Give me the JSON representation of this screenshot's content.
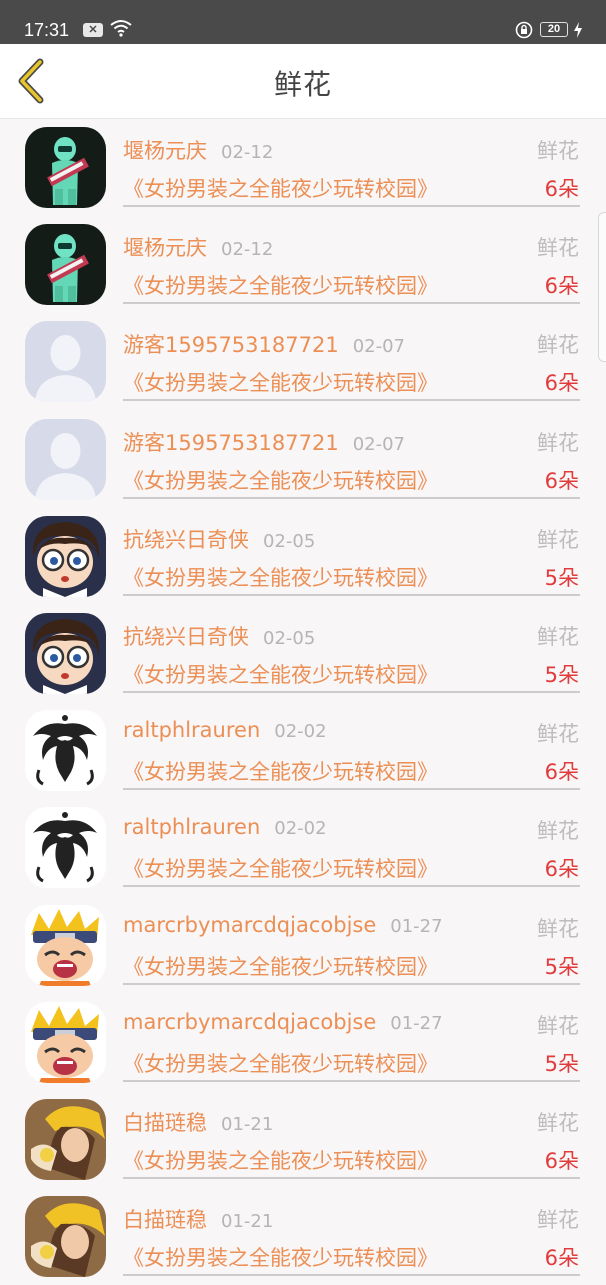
{
  "status": {
    "time": "17:31",
    "battery": "20"
  },
  "header": {
    "title": "鲜花"
  },
  "list": [
    {
      "name": "堰杨元庆",
      "date": "02-12",
      "gift": "鲜花",
      "book": "《女扮男装之全能夜少玩转校园》",
      "count": "6朵",
      "avatar": "astronaut-keytar"
    },
    {
      "name": "堰杨元庆",
      "date": "02-12",
      "gift": "鲜花",
      "book": "《女扮男装之全能夜少玩转校园》",
      "count": "6朵",
      "avatar": "astronaut-keytar"
    },
    {
      "name": "游客1595753187721",
      "date": "02-07",
      "gift": "鲜花",
      "book": "《女扮男装之全能夜少玩转校园》",
      "count": "6朵",
      "avatar": "default-person"
    },
    {
      "name": "游客1595753187721",
      "date": "02-07",
      "gift": "鲜花",
      "book": "《女扮男装之全能夜少玩转校园》",
      "count": "6朵",
      "avatar": "default-person"
    },
    {
      "name": "抗绕兴日奇侠",
      "date": "02-05",
      "gift": "鲜花",
      "book": "《女扮男装之全能夜少玩转校园》",
      "count": "5朵",
      "avatar": "anime-glasses-boy"
    },
    {
      "name": "抗绕兴日奇侠",
      "date": "02-05",
      "gift": "鲜花",
      "book": "《女扮男装之全能夜少玩转校园》",
      "count": "5朵",
      "avatar": "anime-glasses-boy"
    },
    {
      "name": "raltphlrauren",
      "date": "02-02",
      "gift": "鲜花",
      "book": "《女扮男装之全能夜少玩转校园》",
      "count": "6朵",
      "avatar": "tribal-symbol"
    },
    {
      "name": "raltphlrauren",
      "date": "02-02",
      "gift": "鲜花",
      "book": "《女扮男装之全能夜少玩转校园》",
      "count": "6朵",
      "avatar": "tribal-symbol"
    },
    {
      "name": "marcrbymarcdqjacobjse",
      "date": "01-27",
      "gift": "鲜花",
      "book": "《女扮男装之全能夜少玩转校园》",
      "count": "5朵",
      "avatar": "anime-ninja"
    },
    {
      "name": "marcrbymarcdqjacobjse",
      "date": "01-27",
      "gift": "鲜花",
      "book": "《女扮男装之全能夜少玩转校园》",
      "count": "5朵",
      "avatar": "anime-ninja"
    },
    {
      "name": "白描琏稳",
      "date": "01-21",
      "gift": "鲜花",
      "book": "《女扮男装之全能夜少玩转校园》",
      "count": "6朵",
      "avatar": "girl-yellow-hat"
    },
    {
      "name": "白描琏稳",
      "date": "01-21",
      "gift": "鲜花",
      "book": "《女扮男装之全能夜少玩转校园》",
      "count": "6朵",
      "avatar": "girl-yellow-hat"
    }
  ],
  "colors": {
    "accent": "#ec8f55",
    "count": "#e23b3b",
    "muted": "#bdbdbd",
    "back": "#e7c52b"
  }
}
